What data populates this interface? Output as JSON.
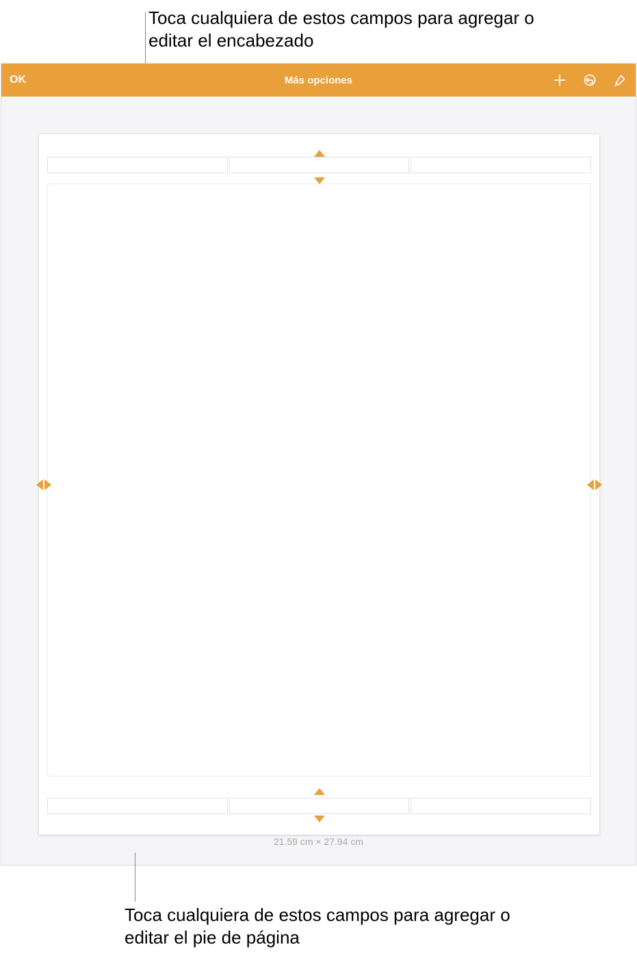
{
  "callouts": {
    "header": "Toca cualquiera de estos campos para agregar o editar el encabezado",
    "footer": "Toca cualquiera de estos campos para agregar o editar el pie de página"
  },
  "toolbar": {
    "ok_label": "OK",
    "title": "Más opciones"
  },
  "page": {
    "dimensions": "21.59 cm × 27.94 cm"
  },
  "colors": {
    "accent": "#e9a03b",
    "canvas_bg": "#f5f5f7",
    "field_border": "#e2e2e2"
  }
}
